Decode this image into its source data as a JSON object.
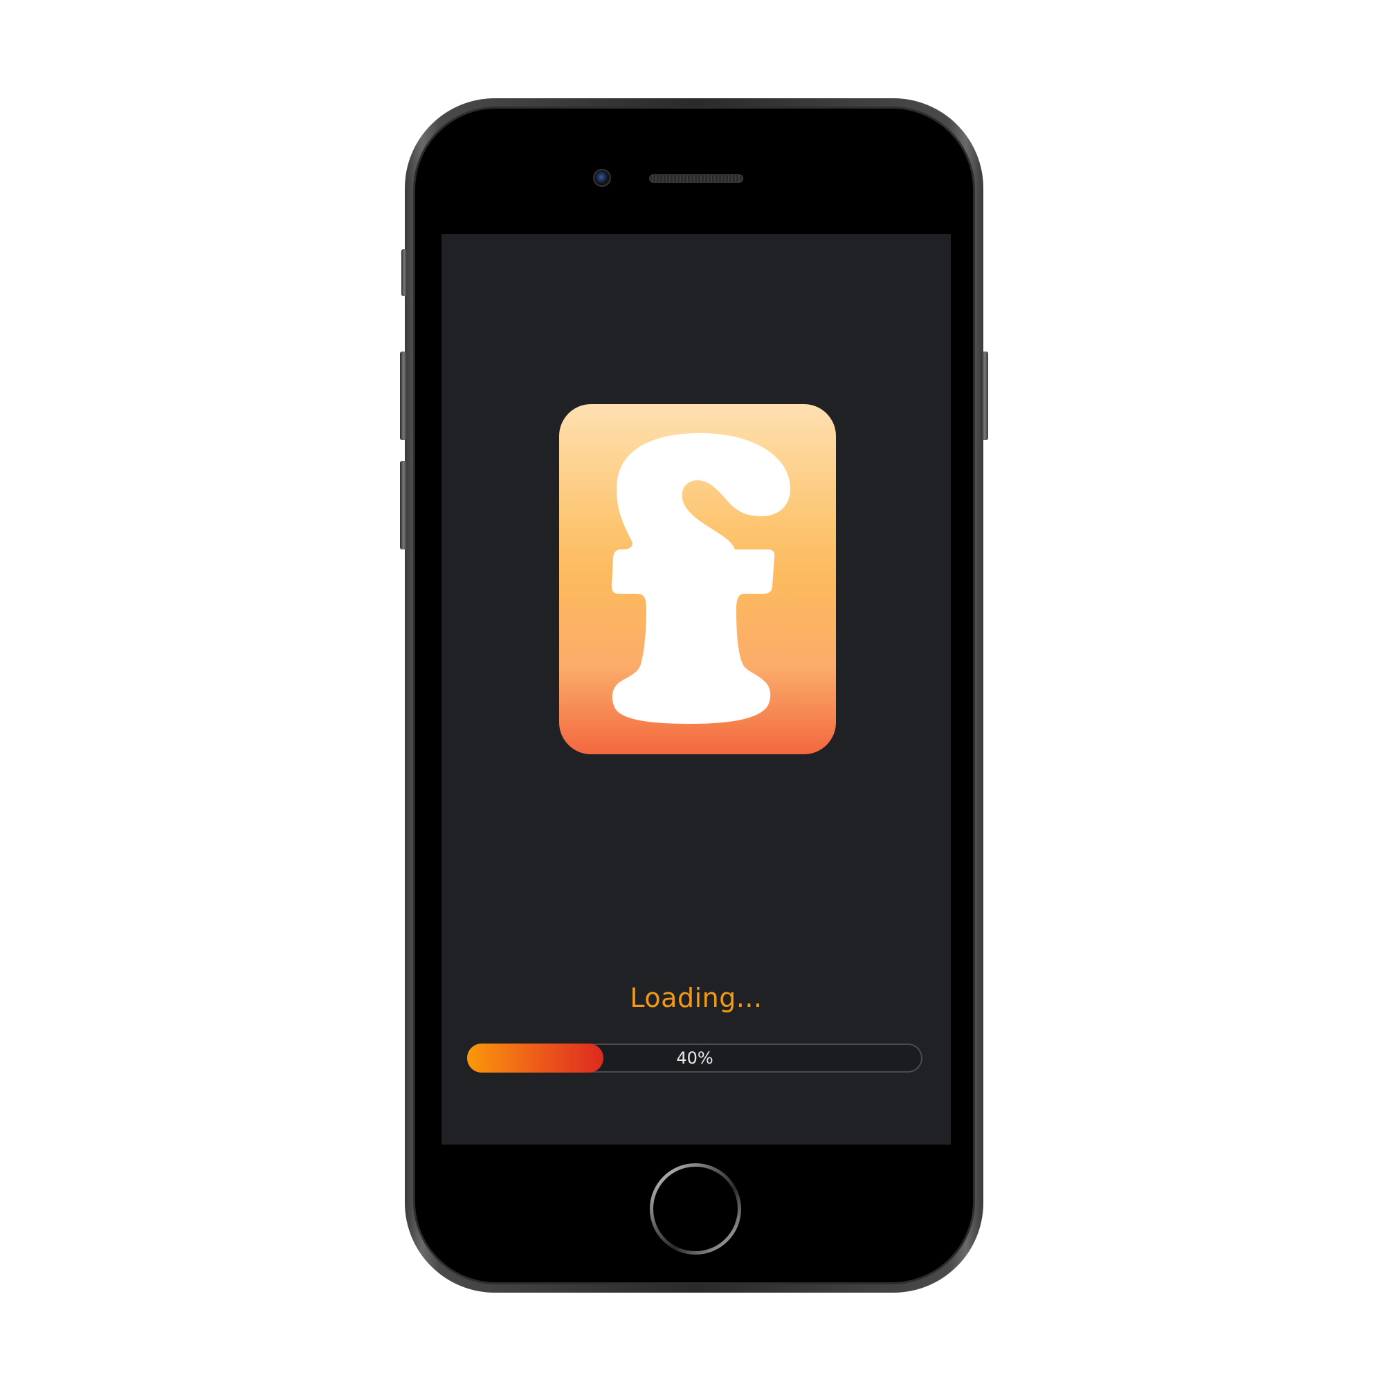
{
  "device": {
    "model": "phone",
    "frame_color": "#2a2a2a",
    "screen_background": "#202125"
  },
  "icons": {
    "app_logo": "app-logo-f-icon",
    "camera": "front-camera-icon",
    "speaker": "earpiece-speaker-icon",
    "home": "home-button-icon"
  },
  "splash": {
    "loading_label": "Loading...",
    "progress": {
      "percent": 40,
      "label": "40%",
      "fill_colors": [
        "#fb980b",
        "#dc2a20"
      ]
    },
    "accent_color": "#f29a18"
  }
}
